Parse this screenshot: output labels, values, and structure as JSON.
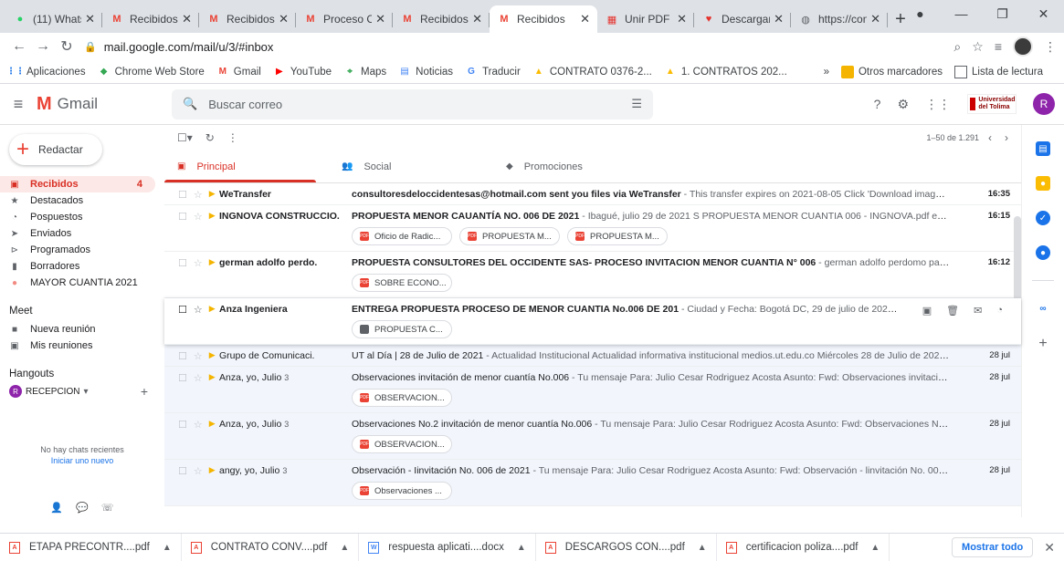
{
  "browser": {
    "tabs": [
      {
        "title": "(11) Whats",
        "icon": "whatsapp-icon",
        "color": "#25d366"
      },
      {
        "title": "Recibidos",
        "icon": "gmail-icon",
        "color": "#ea4335"
      },
      {
        "title": "Recibidos",
        "icon": "gmail-icon",
        "color": "#ea4335"
      },
      {
        "title": "Proceso Co",
        "icon": "gmail-icon",
        "color": "#ea4335"
      },
      {
        "title": "Recibidos",
        "icon": "gmail-icon",
        "color": "#ea4335"
      },
      {
        "title": "Recibidos",
        "icon": "gmail-icon",
        "color": "#ea4335",
        "active": true
      },
      {
        "title": "Unir PDF -",
        "icon": "ilovepdf-icon",
        "color": "#e5322d"
      },
      {
        "title": "Descargar",
        "icon": "heart-icon",
        "color": "#e5322d"
      },
      {
        "title": "https://con",
        "icon": "globe-icon",
        "color": "#5f6368"
      }
    ],
    "url": "mail.google.com/mail/u/3/#inbox",
    "bookmarks": [
      {
        "label": "Aplicaciones",
        "icon": "apps-grid-icon"
      },
      {
        "label": "Chrome Web Store",
        "icon": "chrome-store-icon"
      },
      {
        "label": "Gmail",
        "icon": "gmail-icon"
      },
      {
        "label": "YouTube",
        "icon": "youtube-icon"
      },
      {
        "label": "Maps",
        "icon": "maps-icon"
      },
      {
        "label": "Noticias",
        "icon": "news-icon"
      },
      {
        "label": "Traducir",
        "icon": "translate-icon"
      },
      {
        "label": "CONTRATO 0376-2...",
        "icon": "drive-icon"
      },
      {
        "label": "1. CONTRATOS 202...",
        "icon": "drive-icon"
      }
    ],
    "bookmarks_more": "»",
    "other_bookmarks": "Otros marcadores",
    "reading_list": "Lista de lectura"
  },
  "gmail": {
    "logo_text": "Gmail",
    "search_placeholder": "Buscar correo",
    "org_logo": "Universidad del Tolima",
    "avatar_letter": "R",
    "compose": "Redactar",
    "nav": [
      {
        "label": "Recibidos",
        "count": "4",
        "icon": "inbox-icon",
        "active": true
      },
      {
        "label": "Destacados",
        "icon": "star-icon"
      },
      {
        "label": "Pospuestos",
        "icon": "clock-icon"
      },
      {
        "label": "Enviados",
        "icon": "send-icon"
      },
      {
        "label": "Programados",
        "icon": "scheduled-icon"
      },
      {
        "label": "Borradores",
        "icon": "draft-icon"
      },
      {
        "label": "MAYOR CUANTIA 2021",
        "icon": "label-icon"
      }
    ],
    "meet": {
      "title": "Meet",
      "items": [
        "Nueva reunión",
        "Mis reuniones"
      ]
    },
    "hangouts": {
      "title": "Hangouts",
      "user": "RECEPCION",
      "no_chats": "No hay chats recientes",
      "start_new": "Iniciar uno nuevo"
    },
    "pagination": "1–50 de 1.291",
    "categories": [
      {
        "label": "Principal",
        "icon": "inbox-icon",
        "active": true
      },
      {
        "label": "Social",
        "icon": "people-icon"
      },
      {
        "label": "Promociones",
        "icon": "tag-icon"
      }
    ],
    "emails": [
      {
        "sender": "WeTransfer",
        "subject": "consultoresdeloccidentesas@hotmail.com sent you files via WeTransfer",
        "snippet": "This transfer expires on 2021-08-05 Click 'Download images' to view imag...",
        "time": "16:35",
        "unread": true,
        "attachments": []
      },
      {
        "sender": "INGNOVA CONSTRUCCIO.",
        "subject": "PROPUESTA MENOR CAUANTÍA NO. 006 DE 2021",
        "snippet": "Ibagué, julio 29 de 2021 S PROPUESTA MENOR CUANTIA 006 - INGNOVA.pdf eñores UNIVERSID...",
        "time": "16:15",
        "unread": true,
        "attachments": [
          "Oficio de Radic...",
          "PROPUESTA M...",
          "PROPUESTA M..."
        ]
      },
      {
        "sender": "german adolfo perdo.",
        "subject": "PROPUESTA CONSULTORES DEL OCCIDENTE SAS- PROCESO INVITACION MENOR CUANTIA N° 006",
        "snippet": "german adolfo perdomo pachon ha compartid...",
        "time": "16:12",
        "unread": true,
        "attachments": [
          "SOBRE ECONO..."
        ]
      },
      {
        "sender": "Anza Ingeniera",
        "subject": "ENTREGA PROPUESTA PROCESO DE MENOR CUANTIA No.006 DE 201",
        "snippet": "Ciudad y Fecha: Bogotá DC, 29 de julio de 2021 Señores UNIVERS...",
        "time": "",
        "unread": true,
        "hovered": true,
        "attachments": [
          "PROPUESTA C..."
        ],
        "doc": true
      },
      {
        "sender": "Grupo de Comunicaci.",
        "subject": "UT al Día | 28 de Julio de 2021",
        "snippet": "Actualidad Institucional Actualidad informativa institucional medios.ut.edu.co Miércoles 28 de Julio de 2021 Últimas ...",
        "time": "28 jul",
        "unread": false,
        "attachments": []
      },
      {
        "sender": "Anza, yo, Julio",
        "count": "3",
        "subject": "Observaciones invitación de menor cuantía No.006",
        "snippet": "Tu mensaje Para: Julio Cesar Rodriguez Acosta Asunto: Fwd: Observaciones invitación de menor...",
        "time": "28 jul",
        "unread": false,
        "attachments": [
          "OBSERVACION..."
        ]
      },
      {
        "sender": "Anza, yo, Julio",
        "count": "3",
        "subject": "Observaciones No.2 invitación de menor cuantía No.006",
        "snippet": "Tu mensaje Para: Julio Cesar Rodriguez Acosta Asunto: Fwd: Observaciones No.2 invitació...",
        "time": "28 jul",
        "unread": false,
        "attachments": [
          "OBSERVACION..."
        ]
      },
      {
        "sender": "angy, yo, Julio",
        "count": "3",
        "subject": "Observación - Iinvitación No. 006 de 2021",
        "snippet": "Tu mensaje Para: Julio Cesar Rodriguez Acosta Asunto: Fwd: Observación - linvitación No. 006 de 2021 F...",
        "time": "28 jul",
        "unread": false,
        "attachments": [
          "Observaciones ..."
        ]
      }
    ]
  },
  "downloads": {
    "items": [
      {
        "name": "ETAPA PRECONTR....pdf",
        "type": "pdf"
      },
      {
        "name": "CONTRATO CONV....pdf",
        "type": "pdf"
      },
      {
        "name": "respuesta aplicati....docx",
        "type": "docx"
      },
      {
        "name": "DESCARGOS CON....pdf",
        "type": "pdf"
      },
      {
        "name": "certificacion poliza....pdf",
        "type": "pdf"
      }
    ],
    "show_all": "Mostrar todo"
  }
}
